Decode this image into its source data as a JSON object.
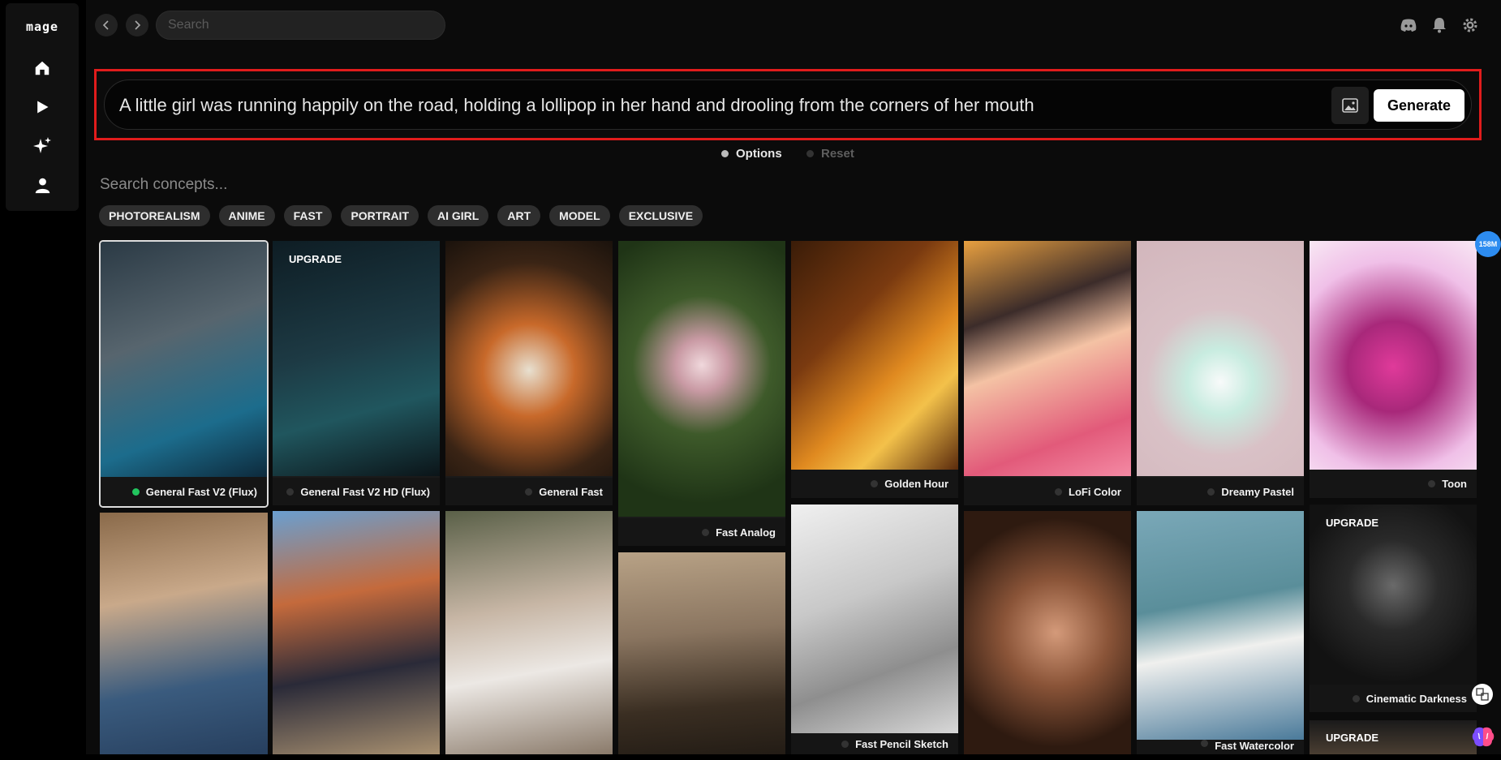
{
  "app": {
    "logo": "mage"
  },
  "sidebar": {
    "items": [
      {
        "name": "home",
        "icon": "home-icon"
      },
      {
        "name": "play",
        "icon": "play-icon"
      },
      {
        "name": "create",
        "icon": "sparkles-icon"
      },
      {
        "name": "profile",
        "icon": "user-icon"
      }
    ]
  },
  "header": {
    "search_placeholder": "Search",
    "icons": [
      "discord-icon",
      "bell-icon",
      "gear-icon"
    ]
  },
  "prompt": {
    "text": "A little girl was running happily on the road, holding a lollipop in her hand and drooling from the corners of her mouth",
    "generate_label": "Generate"
  },
  "options": {
    "options_label": "Options",
    "reset_label": "Reset"
  },
  "concepts": {
    "placeholder": "Search concepts...",
    "tags": [
      "PHOTOREALISM",
      "ANIME",
      "FAST",
      "PORTRAIT",
      "AI GIRL",
      "ART",
      "MODEL",
      "EXCLUSIVE"
    ]
  },
  "models": [
    {
      "label": "General Fast V2 (Flux)",
      "status_color": "#22c55e",
      "selected": true
    },
    {
      "label": "General Fast V2 HD (Flux)",
      "upgrade": "UPGRADE"
    },
    {
      "label": "General Fast"
    },
    {
      "label": "Fast Analog"
    },
    {
      "label": "Golden Hour"
    },
    {
      "label": "LoFi Color"
    },
    {
      "label": "Dreamy Pastel"
    },
    {
      "label": "Toon"
    },
    {
      "label": "Fast Pencil Sketch"
    },
    {
      "label": "Cinematic Darkness",
      "upgrade": "UPGRADE"
    },
    {
      "label": "Fast Watercolor"
    },
    {
      "upgrade": "UPGRADE"
    }
  ],
  "badge": {
    "text": "158M"
  },
  "colors": {
    "accent_frame": "#e01c1c",
    "active_dot": "#22c55e",
    "badge_blue": "#2d8cf0"
  }
}
